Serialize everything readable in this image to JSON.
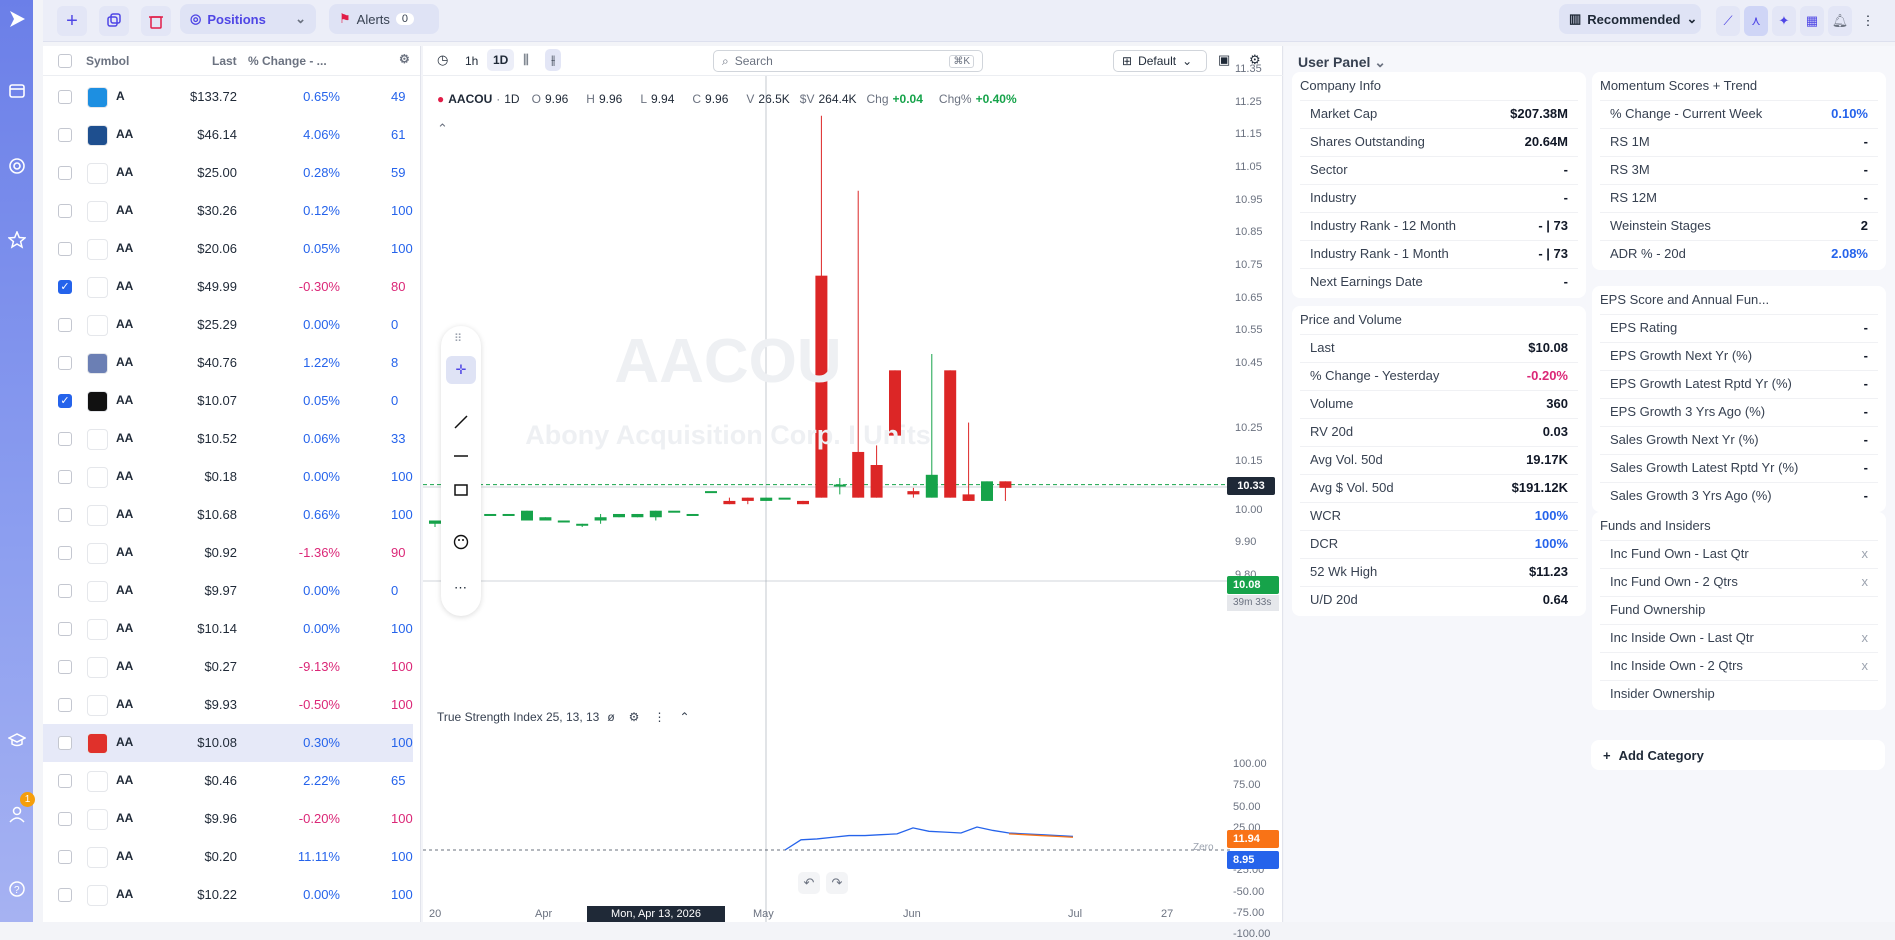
{
  "toolbar": {
    "positions_label": "Positions",
    "alerts_label": "Alerts",
    "alerts_count": "0",
    "recommended_label": "Recommended"
  },
  "watchlist": {
    "headers": {
      "symbol": "Symbol",
      "last": "Last",
      "change": "% Change - ..."
    },
    "rows": [
      {
        "sym": "A",
        "last": "$133.72",
        "pct": "0.65%",
        "c4": "49",
        "dir": "pos",
        "logo": "#1d8fe1",
        "checked": false
      },
      {
        "sym": "AA",
        "last": "$46.14",
        "pct": "4.06%",
        "c4": "61",
        "dir": "pos",
        "logo": "#1e4f8f",
        "checked": false
      },
      {
        "sym": "AA",
        "last": "$25.00",
        "pct": "0.28%",
        "c4": "59",
        "dir": "pos",
        "logo": "#ffffff",
        "checked": false
      },
      {
        "sym": "AA",
        "last": "$30.26",
        "pct": "0.12%",
        "c4": "100",
        "dir": "pos",
        "logo": "#ffffff",
        "checked": false
      },
      {
        "sym": "AA",
        "last": "$20.06",
        "pct": "0.05%",
        "c4": "100",
        "dir": "pos",
        "logo": "#ffffff",
        "checked": false
      },
      {
        "sym": "AA",
        "last": "$49.99",
        "pct": "-0.30%",
        "c4": "80",
        "dir": "neg",
        "logo": "#ffffff",
        "checked": true
      },
      {
        "sym": "AA",
        "last": "$25.29",
        "pct": "0.00%",
        "c4": "0",
        "dir": "neu",
        "logo": "#ffffff",
        "checked": false
      },
      {
        "sym": "AA",
        "last": "$40.76",
        "pct": "1.22%",
        "c4": "8",
        "dir": "pos",
        "logo": "#6b7fb4",
        "checked": false
      },
      {
        "sym": "AA",
        "last": "$10.07",
        "pct": "0.05%",
        "c4": "0",
        "dir": "pos",
        "logo": "#111111",
        "checked": true
      },
      {
        "sym": "AA",
        "last": "$10.52",
        "pct": "0.06%",
        "c4": "33",
        "dir": "pos",
        "logo": "#ffffff",
        "checked": false
      },
      {
        "sym": "AA",
        "last": "$0.18",
        "pct": "0.00%",
        "c4": "100",
        "dir": "neu",
        "logo": "#ffffff",
        "checked": false
      },
      {
        "sym": "AA",
        "last": "$10.68",
        "pct": "0.66%",
        "c4": "100",
        "dir": "pos",
        "logo": "#ffffff",
        "checked": false
      },
      {
        "sym": "AA",
        "last": "$0.92",
        "pct": "-1.36%",
        "c4": "90",
        "dir": "neg",
        "logo": "#ffffff",
        "checked": false
      },
      {
        "sym": "AA",
        "last": "$9.97",
        "pct": "0.00%",
        "c4": "0",
        "dir": "neu",
        "logo": "#ffffff",
        "checked": false
      },
      {
        "sym": "AA",
        "last": "$10.14",
        "pct": "0.00%",
        "c4": "100",
        "dir": "neu",
        "logo": "#ffffff",
        "checked": false
      },
      {
        "sym": "AA",
        "last": "$0.27",
        "pct": "-9.13%",
        "c4": "100",
        "dir": "neg",
        "logo": "#ffffff",
        "checked": false
      },
      {
        "sym": "AA",
        "last": "$9.93",
        "pct": "-0.50%",
        "c4": "100",
        "dir": "neg",
        "logo": "#ffffff",
        "checked": false
      },
      {
        "sym": "AA",
        "last": "$10.08",
        "pct": "0.30%",
        "c4": "100",
        "dir": "pos",
        "logo": "#e0312b",
        "checked": false
      },
      {
        "sym": "AA",
        "last": "$0.46",
        "pct": "2.22%",
        "c4": "65",
        "dir": "pos",
        "logo": "#ffffff",
        "checked": false
      },
      {
        "sym": "AA",
        "last": "$9.96",
        "pct": "-0.20%",
        "c4": "100",
        "dir": "neg",
        "logo": "#ffffff",
        "checked": false
      },
      {
        "sym": "AA",
        "last": "$0.20",
        "pct": "11.11%",
        "c4": "100",
        "dir": "pos",
        "logo": "#ffffff",
        "checked": false
      },
      {
        "sym": "AA",
        "last": "$10.22",
        "pct": "0.00%",
        "c4": "100",
        "dir": "neu",
        "logo": "#ffffff",
        "checked": false
      }
    ]
  },
  "chart": {
    "toolbar": {
      "tf1": "1h",
      "tf2": "1D",
      "search_placeholder": "Search",
      "search_shortcut": "⌘K",
      "layout": "Default"
    },
    "ohlc": {
      "symbol": "AACOU",
      "tf": "1D",
      "o": "9.96",
      "h": "9.96",
      "l": "9.94",
      "c": "9.96",
      "v": "26.5K",
      "sv": "264.4K",
      "chg": "+0.04",
      "chgp": "+0.40%"
    },
    "watermark": {
      "symbol": "AACOU",
      "name": "Abony Acquisition Corp. I Units"
    },
    "crosshair_price": "10.33",
    "last_price": "10.08",
    "countdown": "39m 33s",
    "indicator": {
      "name": "True Strength Index 25, 13, 13",
      "value1": "11.94",
      "value2": "8.95",
      "zero_label": "Zero"
    },
    "date_label": "Mon, Apr 13, 2026",
    "x_labels": [
      "20",
      "Apr",
      "May",
      "Jun",
      "Jul",
      "27"
    ],
    "price_ticks": [
      "11.35",
      "11.25",
      "11.15",
      "11.05",
      "10.95",
      "10.85",
      "10.75",
      "10.65",
      "10.55",
      "10.45",
      "10.25",
      "10.15",
      "10.00",
      "9.90",
      "9.80"
    ],
    "tsi_ticks": [
      "100.00",
      "75.00",
      "50.00",
      "25.00",
      "-25.00",
      "-50.00",
      "-75.00",
      "-100.00"
    ]
  },
  "chart_data": {
    "type": "candlestick",
    "ylim": [
      9.8,
      11.35
    ],
    "candles": [
      {
        "o": 9.96,
        "c": 9.97,
        "h": 9.97,
        "l": 9.95,
        "col": "g"
      },
      {
        "o": 9.97,
        "c": 9.98,
        "h": 9.98,
        "l": 9.97,
        "col": "g"
      },
      {
        "o": 9.98,
        "c": 9.98,
        "h": 9.98,
        "l": 9.98,
        "col": "g"
      },
      {
        "o": 9.99,
        "c": 9.99,
        "h": 9.99,
        "l": 9.99,
        "col": "g"
      },
      {
        "o": 9.99,
        "c": 9.99,
        "h": 9.99,
        "l": 9.99,
        "col": "g"
      },
      {
        "o": 9.97,
        "c": 10.0,
        "h": 10.0,
        "l": 9.97,
        "col": "g"
      },
      {
        "o": 9.97,
        "c": 9.98,
        "h": 9.98,
        "l": 9.97,
        "col": "g"
      },
      {
        "o": 9.97,
        "c": 9.97,
        "h": 9.97,
        "l": 9.97,
        "col": "g"
      },
      {
        "o": 9.96,
        "c": 9.96,
        "h": 9.96,
        "l": 9.95,
        "col": "g"
      },
      {
        "o": 9.97,
        "c": 9.98,
        "h": 9.99,
        "l": 9.96,
        "col": "g"
      },
      {
        "o": 9.98,
        "c": 9.99,
        "h": 9.99,
        "l": 9.98,
        "col": "g"
      },
      {
        "o": 9.98,
        "c": 9.99,
        "h": 9.99,
        "l": 9.98,
        "col": "g"
      },
      {
        "o": 9.98,
        "c": 10.0,
        "h": 10.0,
        "l": 9.97,
        "col": "g"
      },
      {
        "o": 10.0,
        "c": 10.0,
        "h": 10.0,
        "l": 10.0,
        "col": "g"
      },
      {
        "o": 9.99,
        "c": 9.99,
        "h": 9.99,
        "l": 9.99,
        "col": "g"
      },
      {
        "o": 10.06,
        "c": 10.06,
        "h": 10.06,
        "l": 10.06,
        "col": "g"
      },
      {
        "o": 10.03,
        "c": 10.02,
        "h": 10.04,
        "l": 10.02,
        "col": "r"
      },
      {
        "o": 10.04,
        "c": 10.03,
        "h": 10.04,
        "l": 10.02,
        "col": "r"
      },
      {
        "o": 10.03,
        "c": 10.04,
        "h": 10.04,
        "l": 10.03,
        "col": "g"
      },
      {
        "o": 10.04,
        "c": 10.04,
        "h": 10.04,
        "l": 10.04,
        "col": "g"
      },
      {
        "o": 10.03,
        "c": 10.02,
        "h": 10.03,
        "l": 10.02,
        "col": "r"
      },
      {
        "o": 10.72,
        "c": 10.04,
        "h": 11.21,
        "l": 10.04,
        "col": "r"
      },
      {
        "o": 10.08,
        "c": 10.08,
        "h": 10.1,
        "l": 10.05,
        "col": "g"
      },
      {
        "o": 10.18,
        "c": 10.04,
        "h": 10.98,
        "l": 10.04,
        "col": "r"
      },
      {
        "o": 10.14,
        "c": 10.04,
        "h": 10.2,
        "l": 10.04,
        "col": "r"
      },
      {
        "o": 10.43,
        "c": 10.23,
        "h": 10.43,
        "l": 10.23,
        "col": "r"
      },
      {
        "o": 10.06,
        "c": 10.05,
        "h": 10.07,
        "l": 10.04,
        "col": "r"
      },
      {
        "o": 10.04,
        "c": 10.11,
        "h": 10.48,
        "l": 10.04,
        "col": "g"
      },
      {
        "o": 10.43,
        "c": 10.04,
        "h": 10.43,
        "l": 10.04,
        "col": "r"
      },
      {
        "o": 10.05,
        "c": 10.03,
        "h": 10.27,
        "l": 10.03,
        "col": "r"
      },
      {
        "o": 10.03,
        "c": 10.09,
        "h": 10.09,
        "l": 10.03,
        "col": "g"
      },
      {
        "o": 10.09,
        "c": 10.07,
        "h": 10.09,
        "l": 10.03,
        "col": "r"
      }
    ],
    "tsi": [
      0,
      12,
      13,
      15,
      17,
      17,
      18,
      19,
      26,
      22,
      21,
      20,
      27,
      23,
      20,
      19,
      18,
      17,
      16
    ],
    "tsi_signal": [
      null,
      null,
      null,
      null,
      null,
      null,
      null,
      null,
      null,
      null,
      null,
      null,
      null,
      null,
      19,
      18,
      17,
      16,
      15
    ]
  },
  "userpanel": {
    "title": "User Panel",
    "company": {
      "title": "Company Info",
      "items": [
        {
          "k": "Market Cap",
          "v": "$207.38M"
        },
        {
          "k": "Shares Outstanding",
          "v": "20.64M"
        },
        {
          "k": "Sector",
          "v": "-"
        },
        {
          "k": "Industry",
          "v": "-"
        },
        {
          "k": "Industry Rank - 12 Month",
          "v": "- | 73"
        },
        {
          "k": "Industry Rank - 1 Month",
          "v": "- | 73"
        },
        {
          "k": "Next Earnings Date",
          "v": "-"
        }
      ]
    },
    "price": {
      "title": "Price and Volume",
      "items": [
        {
          "k": "Last",
          "v": "$10.08"
        },
        {
          "k": "% Change - Yesterday",
          "v": "-0.20%"
        },
        {
          "k": "Volume",
          "v": "360"
        },
        {
          "k": "RV 20d",
          "v": "0.03"
        },
        {
          "k": "Avg Vol. 50d",
          "v": "19.17K"
        },
        {
          "k": "Avg $ Vol. 50d",
          "v": "$191.12K"
        },
        {
          "k": "WCR",
          "v": "100%"
        },
        {
          "k": "DCR",
          "v": "100%"
        },
        {
          "k": "52 Wk High",
          "v": "$11.23"
        },
        {
          "k": "U/D 20d",
          "v": "0.64"
        }
      ]
    },
    "momentum": {
      "title": "Momentum Scores + Trend",
      "items": [
        {
          "k": "% Change - Current Week",
          "v": "0.10%"
        },
        {
          "k": "RS 1M",
          "v": "-"
        },
        {
          "k": "RS 3M",
          "v": "-"
        },
        {
          "k": "RS 12M",
          "v": "-"
        },
        {
          "k": "Weinstein Stages",
          "v": "2"
        },
        {
          "k": "ADR % - 20d",
          "v": "2.08%"
        }
      ]
    },
    "eps": {
      "title": "EPS Score and Annual Fun...",
      "items": [
        {
          "k": "EPS Rating",
          "v": "-"
        },
        {
          "k": "EPS Growth Next Yr (%)",
          "v": "-"
        },
        {
          "k": "EPS Growth Latest Rptd Yr (%)",
          "v": "-"
        },
        {
          "k": "EPS Growth 3 Yrs Ago (%)",
          "v": "-"
        },
        {
          "k": "Sales Growth Next Yr (%)",
          "v": "-"
        },
        {
          "k": "Sales Growth Latest Rptd Yr (%)",
          "v": "-"
        },
        {
          "k": "Sales Growth 3 Yrs Ago (%)",
          "v": "-"
        }
      ]
    },
    "funds": {
      "title": "Funds and Insiders",
      "items": [
        {
          "k": "Inc Fund Own - Last Qtr",
          "v": "x"
        },
        {
          "k": "Inc Fund Own - 2 Qtrs",
          "v": "x"
        },
        {
          "k": "Fund Ownership",
          "v": ""
        },
        {
          "k": "Inc Inside Own - Last Qtr",
          "v": "x"
        },
        {
          "k": "Inc Inside Own - 2 Qtrs",
          "v": "x"
        },
        {
          "k": "Insider Ownership",
          "v": ""
        }
      ]
    },
    "add_category": "Add Category"
  },
  "nav": {
    "badge": "1"
  }
}
